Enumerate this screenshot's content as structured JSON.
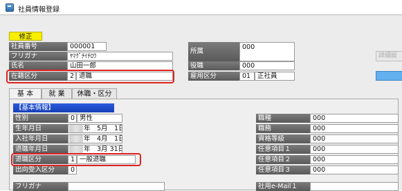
{
  "window": {
    "title": "社員情報登録"
  },
  "mode": {
    "label": "修正"
  },
  "employee": {
    "code_label": "社員番号",
    "code_value": "000001",
    "kana_label": "フリガナ",
    "kana_value": "ﾔﾏｸﾞﾁｲﾁﾛｳ",
    "name_label": "氏名",
    "name_value": "山田一郎",
    "status_label": "在籍区分",
    "status_code": "2",
    "status_value": "退職"
  },
  "org": {
    "dept_label": "所属",
    "dept_code": "000",
    "position_label": "役職",
    "position_code": "000",
    "employment_label": "雇用区分",
    "employment_code": "01",
    "employment_value": "正社員"
  },
  "side_button": {
    "label": "詳細設定"
  },
  "tabs": [
    {
      "label": "基 本"
    },
    {
      "label": "就 業"
    },
    {
      "label": "休職・区分"
    }
  ],
  "basic_info": {
    "section_title": "【基本情報】",
    "gender_label": "性別",
    "gender_code": "0",
    "gender_value": "男性",
    "birth_label": "生年月日",
    "birth_suffix": "年　5月　1日",
    "join_label": "入社年月日",
    "join_suffix": "年　4月　1日",
    "retire_label": "退職年月日",
    "retire_suffix": "年　3月 31日",
    "retire_type_label": "退職区分",
    "retire_type_code": "1",
    "retire_type_value": "一般退職",
    "loan_label": "出向受入区分",
    "loan_code": "0",
    "kana_label": "フリガナ"
  },
  "right_fields": {
    "job_type_label": "職種",
    "job_type_code": "000",
    "duty_label": "職務",
    "duty_code": "000",
    "qualification_label": "資格等級",
    "qualification_code": "000",
    "opt1_label": "任意項目１",
    "opt1_code": "000",
    "opt2_label": "任意項目２",
    "opt2_code": "000",
    "opt3_label": "任意項目３",
    "opt3_code": "000",
    "email_label": "社用e-Mail１"
  },
  "colors": {
    "label_bg": "#5a5a5a",
    "section_header": "#1f4bd0",
    "mode_badge": "#f7ee00",
    "highlight": "#e02020"
  }
}
